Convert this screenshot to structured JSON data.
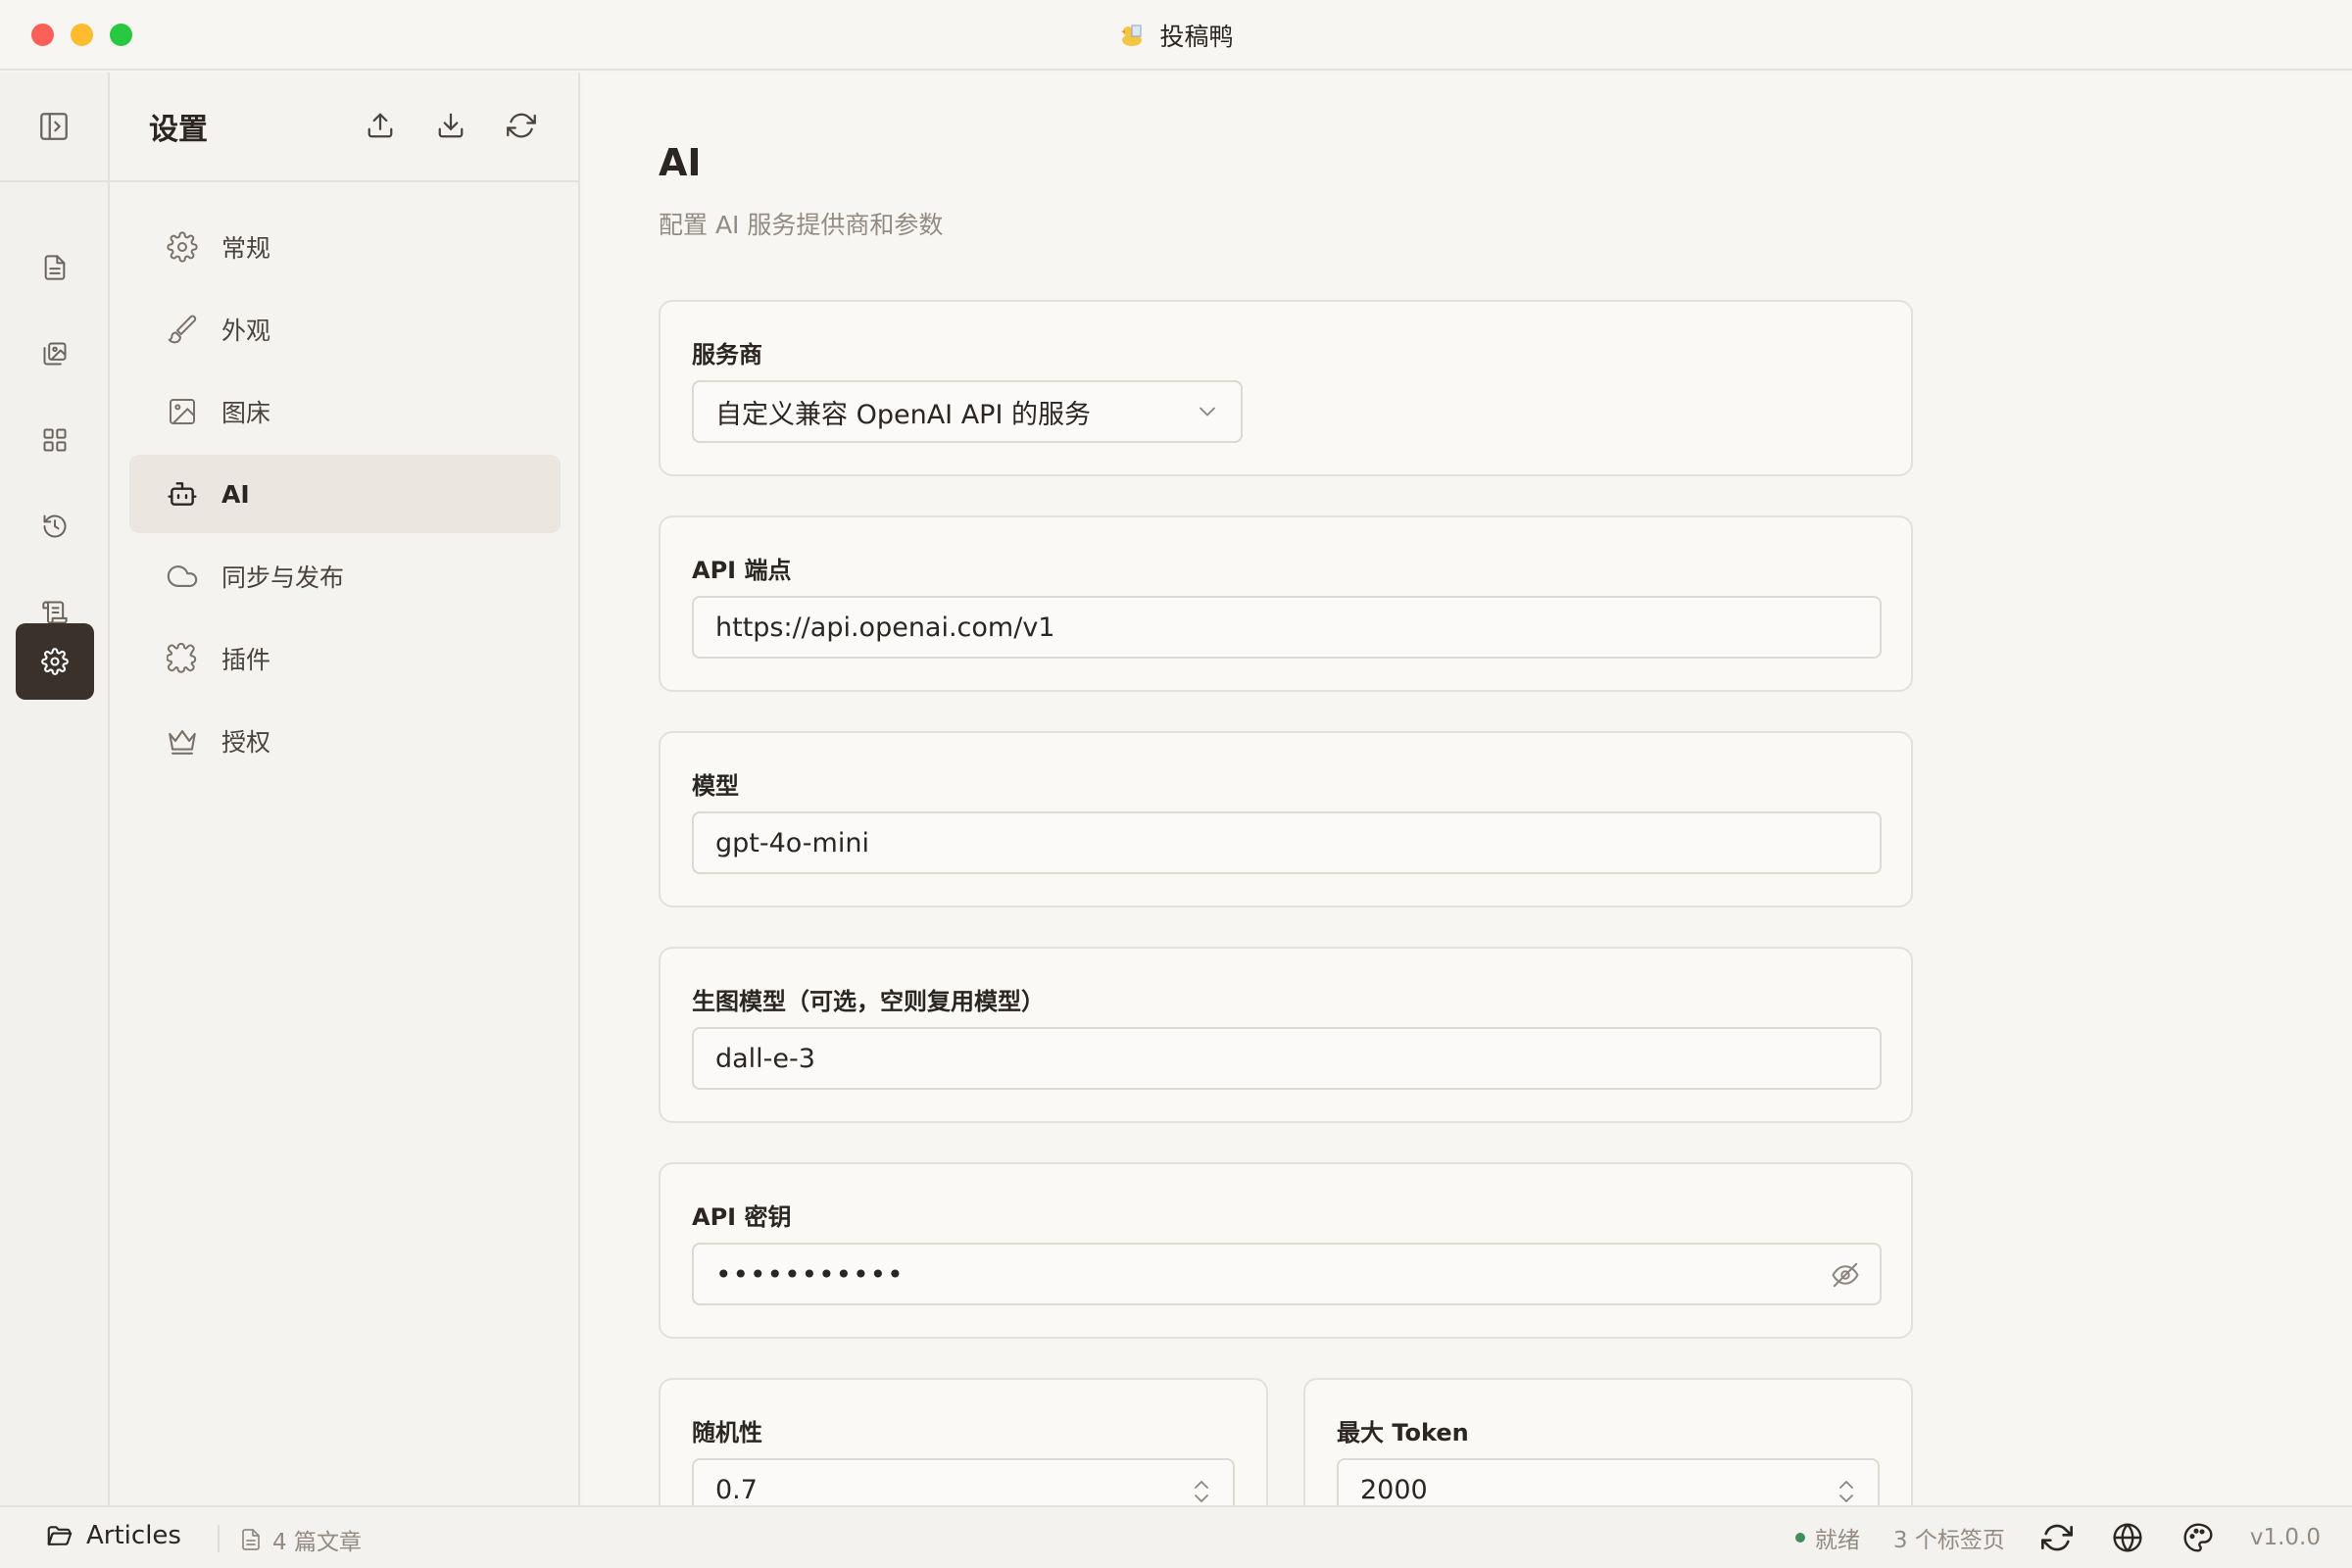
{
  "window": {
    "title": "投稿鸭"
  },
  "settings": {
    "title": "设置",
    "nav": [
      {
        "label": "常规",
        "icon": "gear-icon"
      },
      {
        "label": "外观",
        "icon": "brush-icon"
      },
      {
        "label": "图床",
        "icon": "image-icon"
      },
      {
        "label": "AI",
        "icon": "robot-icon",
        "active": true
      },
      {
        "label": "同步与发布",
        "icon": "cloud-icon"
      },
      {
        "label": "插件",
        "icon": "puzzle-icon"
      },
      {
        "label": "授权",
        "icon": "crown-icon"
      }
    ]
  },
  "main": {
    "title": "AI",
    "subtitle": "配置 AI 服务提供商和参数",
    "provider": {
      "label": "服务商",
      "value": "自定义兼容 OpenAI API 的服务"
    },
    "endpoint": {
      "label": "API 端点",
      "value": "https://api.openai.com/v1"
    },
    "model": {
      "label": "模型",
      "value": "gpt-4o-mini"
    },
    "image_model": {
      "label": "生图模型（可选，空则复用模型）",
      "value": "dall-e-3"
    },
    "api_key": {
      "label": "API 密钥",
      "value": "•••••••••••"
    },
    "temperature": {
      "label": "随机性",
      "value": "0.7"
    },
    "max_tokens": {
      "label": "最大 Token",
      "value": "2000"
    }
  },
  "statusbar": {
    "workspace": "Articles",
    "article_count": "4 篇文章",
    "status": "就绪",
    "tabs": "3 个标签页",
    "version": "v1.0.0"
  },
  "colors": {
    "accent_dark": "#3a312a",
    "status_ready": "#3f8f5b"
  }
}
